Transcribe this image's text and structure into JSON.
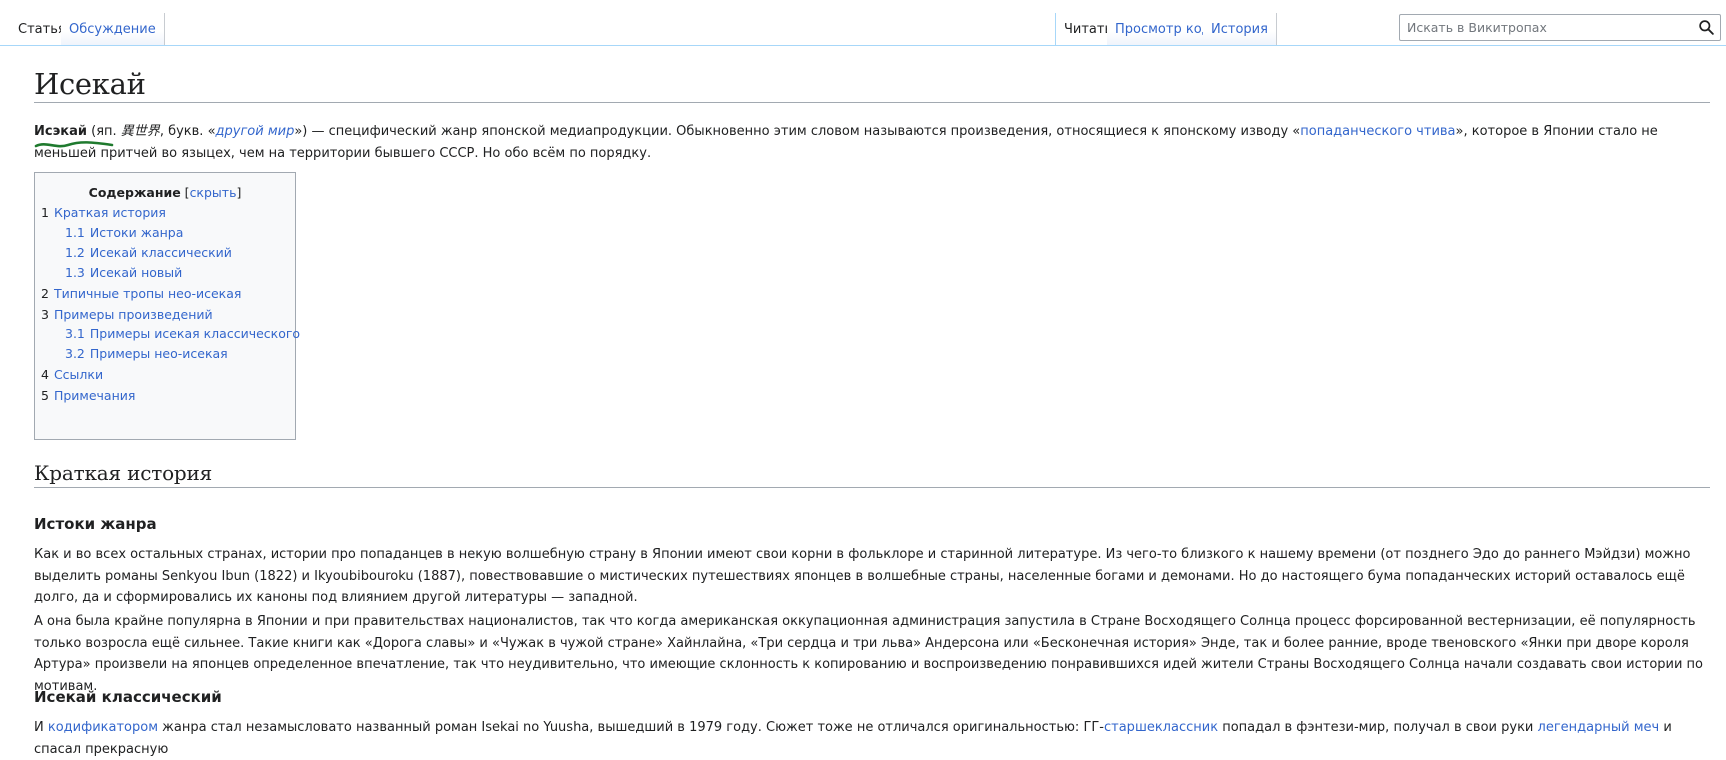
{
  "tabs": {
    "article": "Статья",
    "discussion": "Обсуждение",
    "read": "Читать",
    "view_source": "Просмотр кода",
    "history": "История"
  },
  "search": {
    "placeholder": "Искать в Викитропах",
    "icon": "search-icon"
  },
  "page_title": "Исекай",
  "intro": {
    "term": "Исэкай",
    "p1": " (яп. ",
    "kanji": "異世界",
    "p2": ", букв. «",
    "literal": "другой мир",
    "p3": "») — специфический жанр японской медиапродукции. Обыкновенно этим словом называются произведения, относящиеся к японскому изводу «",
    "link": "попаданческого чтива",
    "p4": "», которое в Японии стало не меньшей притчей во языцех, чем на территории бывшего СССР. Но обо всём по порядку."
  },
  "toc": {
    "title": "Содержание",
    "hide_open": " [",
    "hide": "скрыть",
    "hide_close": "]",
    "items": [
      {
        "num": "1",
        "label": "Краткая история"
      },
      {
        "num": "1.1",
        "label": "Истоки жанра"
      },
      {
        "num": "1.2",
        "label": "Исекай классический"
      },
      {
        "num": "1.3",
        "label": "Исекай новый"
      },
      {
        "num": "2",
        "label": "Типичные тропы нео-исекая"
      },
      {
        "num": "3",
        "label": "Примеры произведений"
      },
      {
        "num": "3.1",
        "label": "Примеры исекая классического"
      },
      {
        "num": "3.2",
        "label": "Примеры нео-исекая"
      },
      {
        "num": "4",
        "label": "Ссылки"
      },
      {
        "num": "5",
        "label": "Примечания"
      }
    ]
  },
  "section1": {
    "heading": "Краткая история",
    "sub1": "Истоки жанра",
    "sub1_para": "Как и во всех остальных странах, истории про попаданцев в некую волшебную страну в Японии имеют свои корни в фольклоре и старинной литературе. Из чего-то близкого к нашему времени (от позднего Эдо до раннего Мэйдзи) можно выделить романы Senkyou Ibun (1822) и Ikyoubibouroku (1887), повествовавшие о мистических путешествиях японцев в волшебные страны, населенные богами и демонами. Но до настоящего бума попаданческих историй оставалось ещё долго, да и сформировались их каноны под влиянием другой литературы — западной.",
    "sub1_para2": "А она была крайне популярна в Японии и при правительствах националистов, так что когда американская оккупационная администрация запустила в Стране Восходящего Солнца процесс форсированной вестернизации, её популярность только возросла ещё сильнее. Такие книги как «Дорога славы» и «Чужак в чужой стране» Хайнлайна, «Три сердца и три льва» Андерсона или «Бесконечная история» Энде, так и более ранние, вроде твеновского «Янки при дворе короля Артура» произвели на японцев определенное впечатление, так что неудивительно, что имеющие склонность к копированию и воспроизведению понравившихся идей жители Страны Восходящего Солнца начали создавать свои истории по мотивам.",
    "sub2": "Исекай классический",
    "sub2_p1": "И ",
    "sub2_link1": "кодификатором",
    "sub2_p2": " жанра стал незамысловато названный роман Isekai no Yuusha, вышедший в 1979 году. Сюжет тоже не отличался оригинальностью: ГГ-",
    "sub2_link2": "старшеклассник",
    "sub2_p3": " попадал в фэнтези-мир, получал в свои руки ",
    "sub2_link3": "легендарный меч",
    "sub2_p4": " и спасал прекрасную"
  },
  "colors": {
    "link": "#3366cc",
    "text": "#202122",
    "underline_mark": "#1f7a2e"
  }
}
